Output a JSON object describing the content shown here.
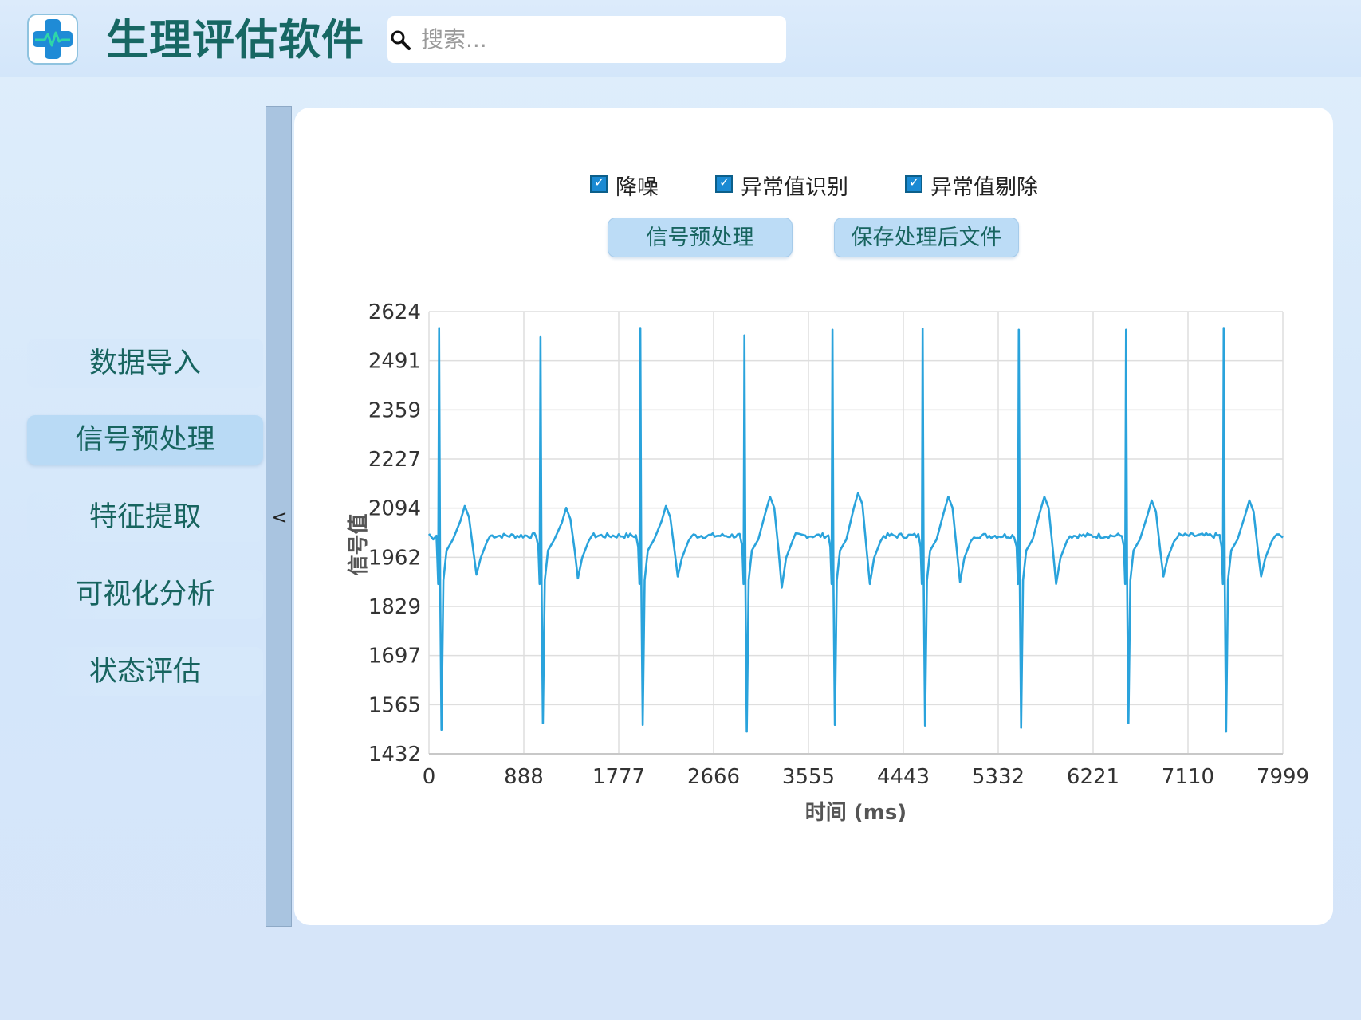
{
  "app": {
    "title": "生理评估软件"
  },
  "search": {
    "placeholder": "搜索..."
  },
  "nav": {
    "items": [
      "数据导入",
      "信号预处理",
      "特征提取",
      "可视化分析",
      "状态评估"
    ],
    "active": "信号预处理"
  },
  "collapse": {
    "glyph": "<"
  },
  "options": {
    "denoise": {
      "label": "降噪",
      "checked": true
    },
    "outlier_detect": {
      "label": "异常值识别",
      "checked": true
    },
    "outlier_remove": {
      "label": "异常值剔除",
      "checked": true
    }
  },
  "buttons": {
    "preprocess": "信号预处理",
    "save": "保存处理后文件"
  },
  "colors": {
    "accent": "#2aa3dc",
    "title": "#176763",
    "nav_active": "#b9daf5"
  },
  "icons": {
    "logo": "heart-pulse-cross-icon",
    "search": "search-icon"
  },
  "chart_data": {
    "type": "line",
    "xlabel": "时间 (ms)",
    "ylabel": "信号值",
    "xlim": [
      0,
      7999
    ],
    "ylim": [
      1432,
      2624
    ],
    "xticks": [
      "0",
      "888",
      "1777",
      "2666",
      "3555",
      "4443",
      "5332",
      "6221",
      "7110",
      "7999"
    ],
    "yticks": [
      "2624",
      "2491",
      "2359",
      "2227",
      "2094",
      "1962",
      "1829",
      "1697",
      "1565",
      "1432"
    ],
    "grid": true,
    "baseline": 2020,
    "series": [
      {
        "beats": [
          {
            "t": 95,
            "r_peak": 2580,
            "s_trough": 1497,
            "t_peak": 2100,
            "dip": 1915
          },
          {
            "t": 1045,
            "r_peak": 2555,
            "s_trough": 1515,
            "t_peak": 2095,
            "dip": 1905
          },
          {
            "t": 1980,
            "r_peak": 2580,
            "s_trough": 1510,
            "t_peak": 2100,
            "dip": 1910
          },
          {
            "t": 2955,
            "r_peak": 2560,
            "s_trough": 1492,
            "t_peak": 2125,
            "dip": 1880
          },
          {
            "t": 3780,
            "r_peak": 2575,
            "s_trough": 1510,
            "t_peak": 2135,
            "dip": 1890
          },
          {
            "t": 4625,
            "r_peak": 2578,
            "s_trough": 1508,
            "t_peak": 2125,
            "dip": 1895
          },
          {
            "t": 5525,
            "r_peak": 2575,
            "s_trough": 1502,
            "t_peak": 2125,
            "dip": 1890
          },
          {
            "t": 6530,
            "r_peak": 2575,
            "s_trough": 1515,
            "t_peak": 2115,
            "dip": 1910
          },
          {
            "t": 7445,
            "r_peak": 2580,
            "s_trough": 1492,
            "t_peak": 2115,
            "dip": 1910
          }
        ]
      }
    ]
  }
}
